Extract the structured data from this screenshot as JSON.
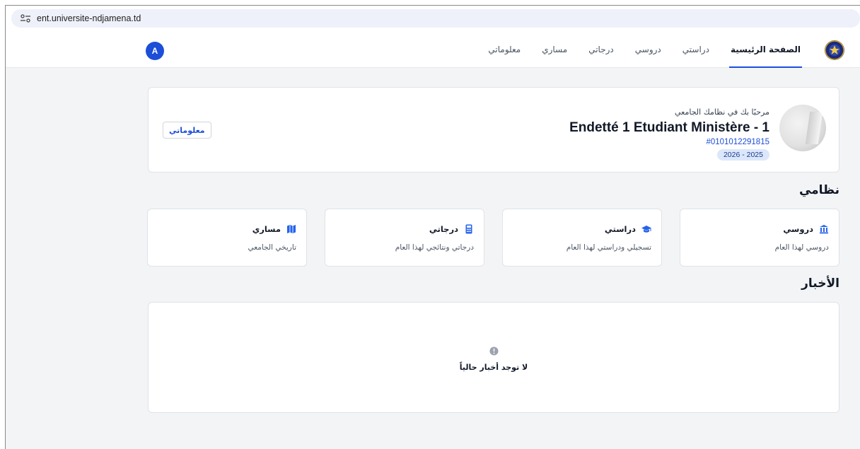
{
  "browser": {
    "url": "ent.universite-ndjamena.td",
    "site_icon": "tune-icon"
  },
  "header": {
    "avatar_letter": "A",
    "logo_icon": "university-logo",
    "nav": [
      {
        "label": "الصفحة الرئيسية",
        "active": true
      },
      {
        "label": "دراستي",
        "active": false
      },
      {
        "label": "دروسي",
        "active": false
      },
      {
        "label": "درجاتي",
        "active": false
      },
      {
        "label": "مساري",
        "active": false
      },
      {
        "label": "معلوماتي",
        "active": false
      }
    ]
  },
  "profile": {
    "welcome": "مرحبًا بك في نظامك الجامعي",
    "name": "Endetté 1 Etudiant Ministère - 1",
    "student_id": "#0101012291815",
    "academic_year": "2026 - 2025",
    "info_button": "معلوماتي"
  },
  "system": {
    "title": "نظامي",
    "tiles": [
      {
        "title": "دروسي",
        "description": "دروسي لهذا العام",
        "icon": "building-columns-icon"
      },
      {
        "title": "دراستي",
        "description": "تسجيلي ودراستي لهذا العام",
        "icon": "graduation-cap-icon"
      },
      {
        "title": "درجاتي",
        "description": "درجاتي ونتائجي لهذا العام",
        "icon": "calculator-icon"
      },
      {
        "title": "مساري",
        "description": "تاريخي الجامعي",
        "icon": "map-icon"
      }
    ]
  },
  "news": {
    "title": "الأخبار",
    "empty_message": "لا توجد أخبار حالياً",
    "empty_icon": "exclamation-circle-icon"
  },
  "colors": {
    "accent": "#1d4ed8",
    "background": "#f3f4f6",
    "badge": "#dbe7fb"
  }
}
